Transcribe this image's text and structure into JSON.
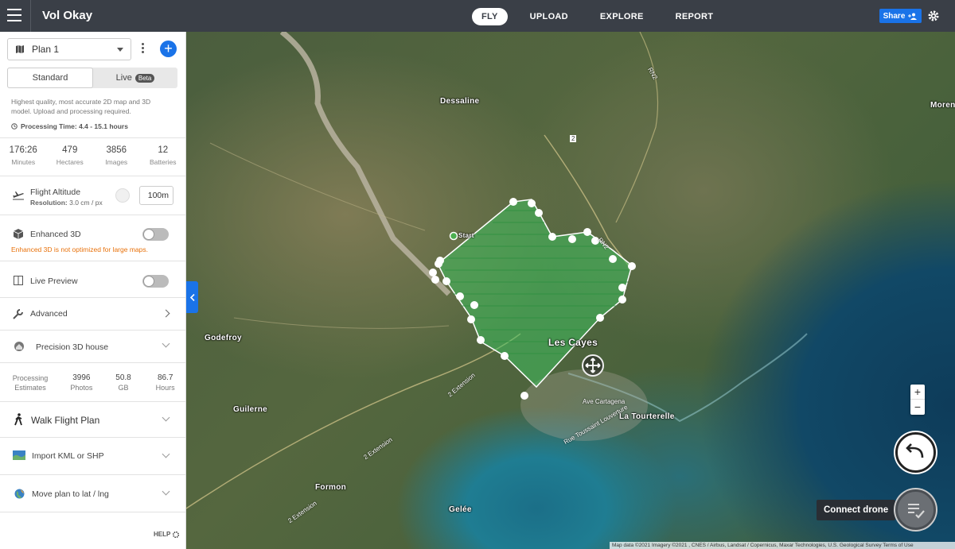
{
  "app": {
    "title": "Vol Okay"
  },
  "nav": {
    "items": [
      "FLY",
      "UPLOAD",
      "EXPLORE",
      "REPORT"
    ],
    "active": "FLY"
  },
  "header": {
    "share_label": "Share"
  },
  "plan": {
    "name": "Plan 1"
  },
  "mode": {
    "standard": "Standard",
    "live": "Live",
    "beta": "Beta"
  },
  "description": "Highest quality, most accurate 2D map and 3D model. Upload and processing required.",
  "processing_time": "Processing Time: 4.4 - 15.1 hours",
  "stats": [
    {
      "value": "176:26",
      "label": "Minutes"
    },
    {
      "value": "479",
      "label": "Hectares"
    },
    {
      "value": "3856",
      "label": "Images"
    },
    {
      "value": "12",
      "label": "Batteries"
    }
  ],
  "flight_altitude": {
    "label": "Flight Altitude",
    "resolution_label": "Resolution:",
    "resolution_value": "3.0 cm / px",
    "value": "100m"
  },
  "enhanced3d": {
    "label": "Enhanced 3D",
    "warning": "Enhanced 3D is not optimized for large maps.",
    "enabled": false
  },
  "live_preview": {
    "label": "Live Preview",
    "enabled": false
  },
  "advanced": {
    "label": "Advanced"
  },
  "precision": {
    "label": "Precision 3D house"
  },
  "processing_estimates": {
    "caption": "Processing Estimates",
    "items": [
      {
        "value": "3996",
        "label": "Photos"
      },
      {
        "value": "50.8",
        "label": "GB"
      },
      {
        "value": "86.7",
        "label": "Hours"
      }
    ]
  },
  "walk_flight_plan": {
    "label": "Walk Flight Plan"
  },
  "import_kml": {
    "label": "Import KML or SHP"
  },
  "move_plan": {
    "label": "Move plan to lat / lng"
  },
  "help": {
    "label": "HELP"
  },
  "map": {
    "labels": {
      "dessaline": "Dessaline",
      "godefroy": "Godefroy",
      "guilerne": "Guilerne",
      "formon": "Formon",
      "gelee": "Gelée",
      "les_cayes": "Les Cayes",
      "la_tourterelle": "La Tourterelle",
      "moren": "Moren",
      "ave_cartagena": "Ave Cartagena",
      "rue_toussaint": "Rue Toussaint Louverture",
      "extension1": "2 Extension",
      "extension2": "2 Extension",
      "extension3": "2 Extension",
      "rn2a": "RN2",
      "rn2b": "RN2",
      "route2": "2",
      "start": "Start"
    },
    "connect_drone": "Connect drone",
    "attribution": "Map data ©2021 Imagery ©2021 , CNES / Airbus, Landsat / Copernicus, Maxar Technologies, U.S. Geological Survey   Terms of Use",
    "accent": "#1a73e8",
    "polygon_color": "#3fbf5f"
  }
}
